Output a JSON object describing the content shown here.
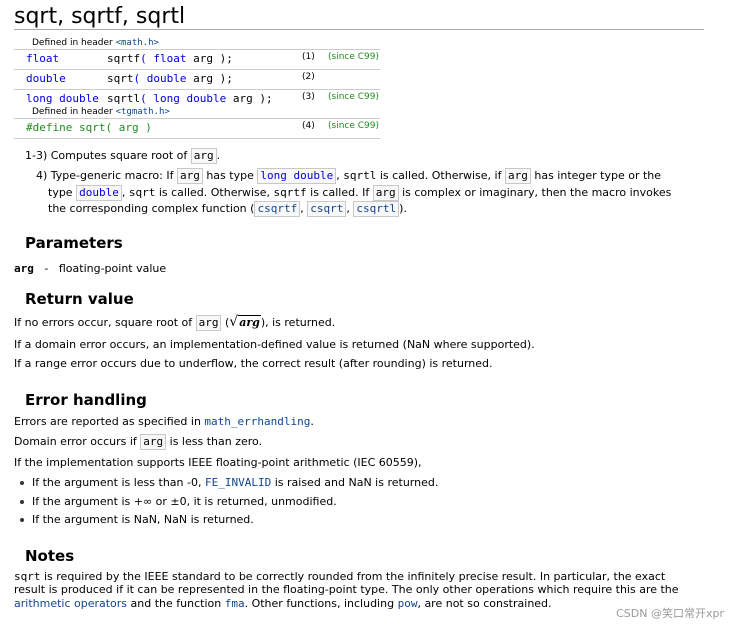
{
  "title": "sqrt, sqrtf, sqrtl",
  "decl": {
    "hdr1_pre": "Defined in header ",
    "hdr1_file": "<math.h>",
    "rows": [
      {
        "ret": "float",
        "name": "sqrtf",
        "ptype": "float",
        "arg": "arg",
        "num": "(1)",
        "since": "(since C99)"
      },
      {
        "ret": "double",
        "name": "sqrt",
        "ptype": "double",
        "arg": "arg",
        "num": "(2)",
        "since": ""
      },
      {
        "ret": "long double",
        "name": "sqrtl",
        "ptype": "long double",
        "arg": "arg",
        "num": "(3)",
        "since": "(since C99)"
      }
    ],
    "hdr2_pre": "Defined in header ",
    "hdr2_file": "<tgmath.h>",
    "macro": "#define sqrt( arg )",
    "macro_num": "(4)",
    "macro_since": "(since C99)"
  },
  "desc": {
    "l1_pre": "1-3) Computes square root of ",
    "arg": "arg",
    "l1_post": ".",
    "l2_a": "4) Type-generic macro: If ",
    "l2_b": " has type ",
    "long_double": "long double",
    "l2_c": ", ",
    "sqrtl": "sqrtl",
    "l2_d": " is called. Otherwise, if ",
    "l2_e": " has integer type or the",
    "l3_a": "type ",
    "double": "double",
    "l3_b": ", ",
    "sqrt": "sqrt",
    "l3_c": " is called. Otherwise, ",
    "sqrtf": "sqrtf",
    "l3_d": " is called. If ",
    "l3_e": " is complex or imaginary, then the macro invokes",
    "l4_a": "the corresponding complex function (",
    "csqrtf": "csqrtf",
    "csqrt": "csqrt",
    "csqrtl": "csqrtl",
    "comma": ", ",
    "l4_b": ")."
  },
  "params": {
    "heading": "Parameters",
    "name": "arg",
    "sep": "-",
    "desc": "floating-point value"
  },
  "ret": {
    "heading": "Return value",
    "l1_pre": "If no errors occur, square root of ",
    "arg": "arg",
    "l1_open": " (",
    "radical": "√",
    "rad_arg": "arg",
    "l1_post": "), is returned.",
    "l2": "If a domain error occurs, an implementation-defined value is returned (NaN where supported).",
    "l3": "If a range error occurs due to underflow, the correct result (after rounding) is returned."
  },
  "err": {
    "heading": "Error handling",
    "l1_pre": "Errors are reported as specified in ",
    "l1_link": "math_errhandling",
    "l1_post": ".",
    "l2_pre": "Domain error occurs if ",
    "arg": "arg",
    "l2_post": " is less than zero.",
    "l3": "If the implementation supports IEEE floating-point arithmetic (IEC 60559),",
    "b1_pre": "If the argument is less than -0, ",
    "b1_link": "FE_INVALID",
    "b1_post": " is raised and NaN is returned.",
    "b2": "If the argument is +∞ or ±0, it is returned, unmodified.",
    "b3": "If the argument is NaN, NaN is returned."
  },
  "notes": {
    "heading": "Notes",
    "l1_code": "sqrt",
    "l1_text": " is required by the IEEE standard to be correctly rounded from the infinitely precise result. In particular, the exact",
    "l2": "result is produced if it can be represented in the floating-point type. The only other operations which require this are the",
    "l3_link1": "arithmetic operators",
    "l3_mid": " and the function ",
    "l3_fma": "fma",
    "l3_mid2": ". Other functions, including ",
    "l3_pow": "pow",
    "l3_post": ", are not so constrained."
  },
  "watermark": "CSDN @笑口常开xpr"
}
